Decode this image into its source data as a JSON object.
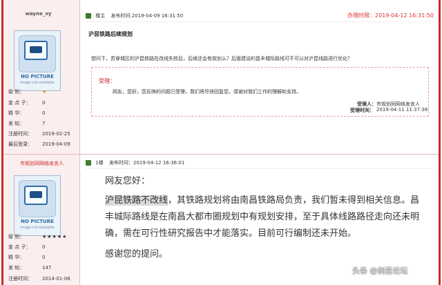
{
  "post1": {
    "username": "wayne_vy",
    "stats": [
      {
        "label": "级    别：",
        "value": "★"
      },
      {
        "label": "金 点 子：",
        "value": "0"
      },
      {
        "label": "精    华：",
        "value": "0"
      },
      {
        "label": "发    帖：",
        "value": "7"
      },
      {
        "label": "注册时间：",
        "value": "2019-02-25"
      },
      {
        "label": "最后登录：",
        "value": "2019-04-09"
      }
    ],
    "header": {
      "floor": "楼主",
      "posted": "发布时间:2019-04-09 16:31:50",
      "handled": "办理时限：2019-04-12 16:31:50"
    },
    "title": "沪昆铁路后续规划",
    "question": "想问下，贯穿城区的沪昆铁路在改线失败后，后续还会有规划么？后面建设的昌丰城际路线可不可以对沪昆线路进行优化？",
    "reply": {
      "label": "受理：",
      "text": "网友，您好，您反映的问题已受理，我们将尽快回复您，感谢对我们工作的理解和支持。",
      "by_label": "受理人：",
      "by_value": "市规划同网络发言人",
      "time_label": "受理时间：",
      "time_value": "2019-04-11 11:37:38"
    }
  },
  "post2": {
    "username": "市规划同网络发言人",
    "stats": [
      {
        "label": "级    别：",
        "value": "★★★★★"
      },
      {
        "label": "金 点 子：",
        "value": "0"
      },
      {
        "label": "精    华：",
        "value": "0"
      },
      {
        "label": "发    帖：",
        "value": "147"
      },
      {
        "label": "注册时间：",
        "value": "2014-01-06"
      }
    ],
    "header": {
      "floor": "1楼",
      "posted": "发布时间：2019-04-12 16:36:01"
    },
    "greeting": "网友您好：",
    "highlight": "沪昆铁路不改线",
    "body": "，其铁路规划将由南昌铁路局负责，我们暂未得到相关信息。昌丰城际路线是在南昌大都市圈规划中有规划安排，至于具体线路路径走向还未明确，需在可行性研究报告中才能落实。目前可行编制还未开始。",
    "thanks": "感谢您的提问。"
  },
  "avatar": {
    "line1": "NO PICTURE",
    "line2": "image not available"
  },
  "watermark": "头条 @剑邑论坛",
  "colors": {
    "accent_red": "#c92a2a",
    "sidebar_bg": "#fbeeee",
    "header_red": "#e03030"
  }
}
